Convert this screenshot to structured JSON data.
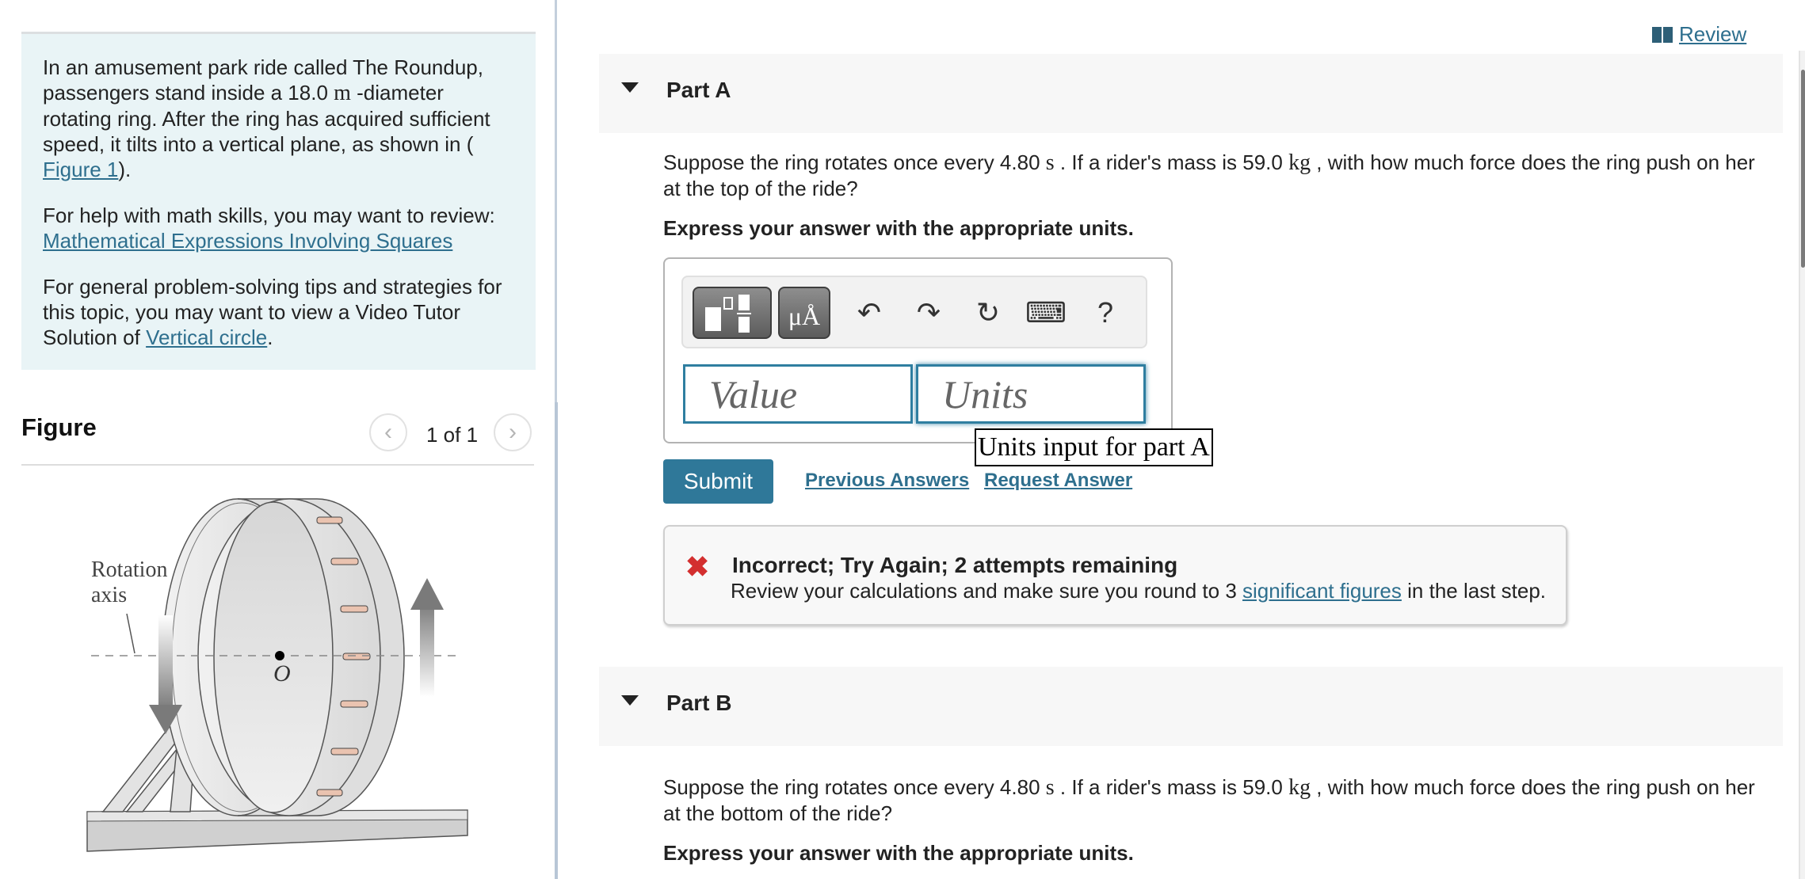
{
  "intro": {
    "p1_before": "In an amusement park ride called The Roundup, passengers stand inside a 18.0 ",
    "p1_unit": "m",
    "p1_after": " -diameter rotating ring. After the ring has acquired sufficient speed, it tilts into a vertical plane, as shown in (",
    "p1_link": "Figure 1",
    "p1_end": ").",
    "p2_text": "For help with math skills, you may want to review:",
    "p2_link": "Mathematical Expressions Involving Squares",
    "p3_text": "For general problem-solving tips and strategies for this topic, you may want to view a Video Tutor Solution of ",
    "p3_link": "Vertical circle",
    "p3_end": "."
  },
  "figure": {
    "title": "Figure",
    "count": "1 of 1",
    "prev_icon": "chevron-left-icon",
    "next_icon": "chevron-right-icon",
    "label_axis_line1": "Rotation",
    "label_axis_line2": "axis",
    "label_center": "O"
  },
  "header": {
    "review_label": " Review",
    "review_icon": "book-icon"
  },
  "partA": {
    "title": "Part A",
    "question_before": "Suppose the ring rotates once every 4.80 ",
    "unit_s": "s",
    "question_mid": " . If a rider's mass is 59.0 ",
    "unit_kg": "kg",
    "question_after": " , with how much force does the ring push on her at the top of the ride?",
    "instruction": "Express your answer with the appropriate units.",
    "toolbar": {
      "templates_icon": "templates-icon",
      "units_label": "μÅ",
      "undo_icon": "↶",
      "redo_icon": "↷",
      "reset_icon": "↻",
      "keyboard_icon": "⌨",
      "help_label": "?"
    },
    "value_placeholder": "Value",
    "units_placeholder": "Units",
    "tooltip": "Units input for part A",
    "submit_label": "Submit",
    "previous_answers_label": "Previous Answers",
    "request_answer_label": "Request Answer",
    "feedback": {
      "icon": "✖",
      "title": "Incorrect; Try Again; 2 attempts remaining",
      "msg_before": "Review your calculations and make sure you round to 3 ",
      "msg_link": "significant figures",
      "msg_after": " in the last step."
    }
  },
  "partB": {
    "title": "Part B",
    "question_before": "Suppose the ring rotates once every 4.80 ",
    "unit_s": "s",
    "question_mid": " . If a rider's mass is 59.0 ",
    "unit_kg": "kg",
    "question_after": " , with how much force does the ring push on her at the bottom of the ride?",
    "instruction": "Express your answer with the appropriate units."
  },
  "colors": {
    "accent": "#2f7899",
    "link": "#2e6f8e",
    "intro_bg": "#e9f4f6",
    "error": "#d32f2f"
  }
}
